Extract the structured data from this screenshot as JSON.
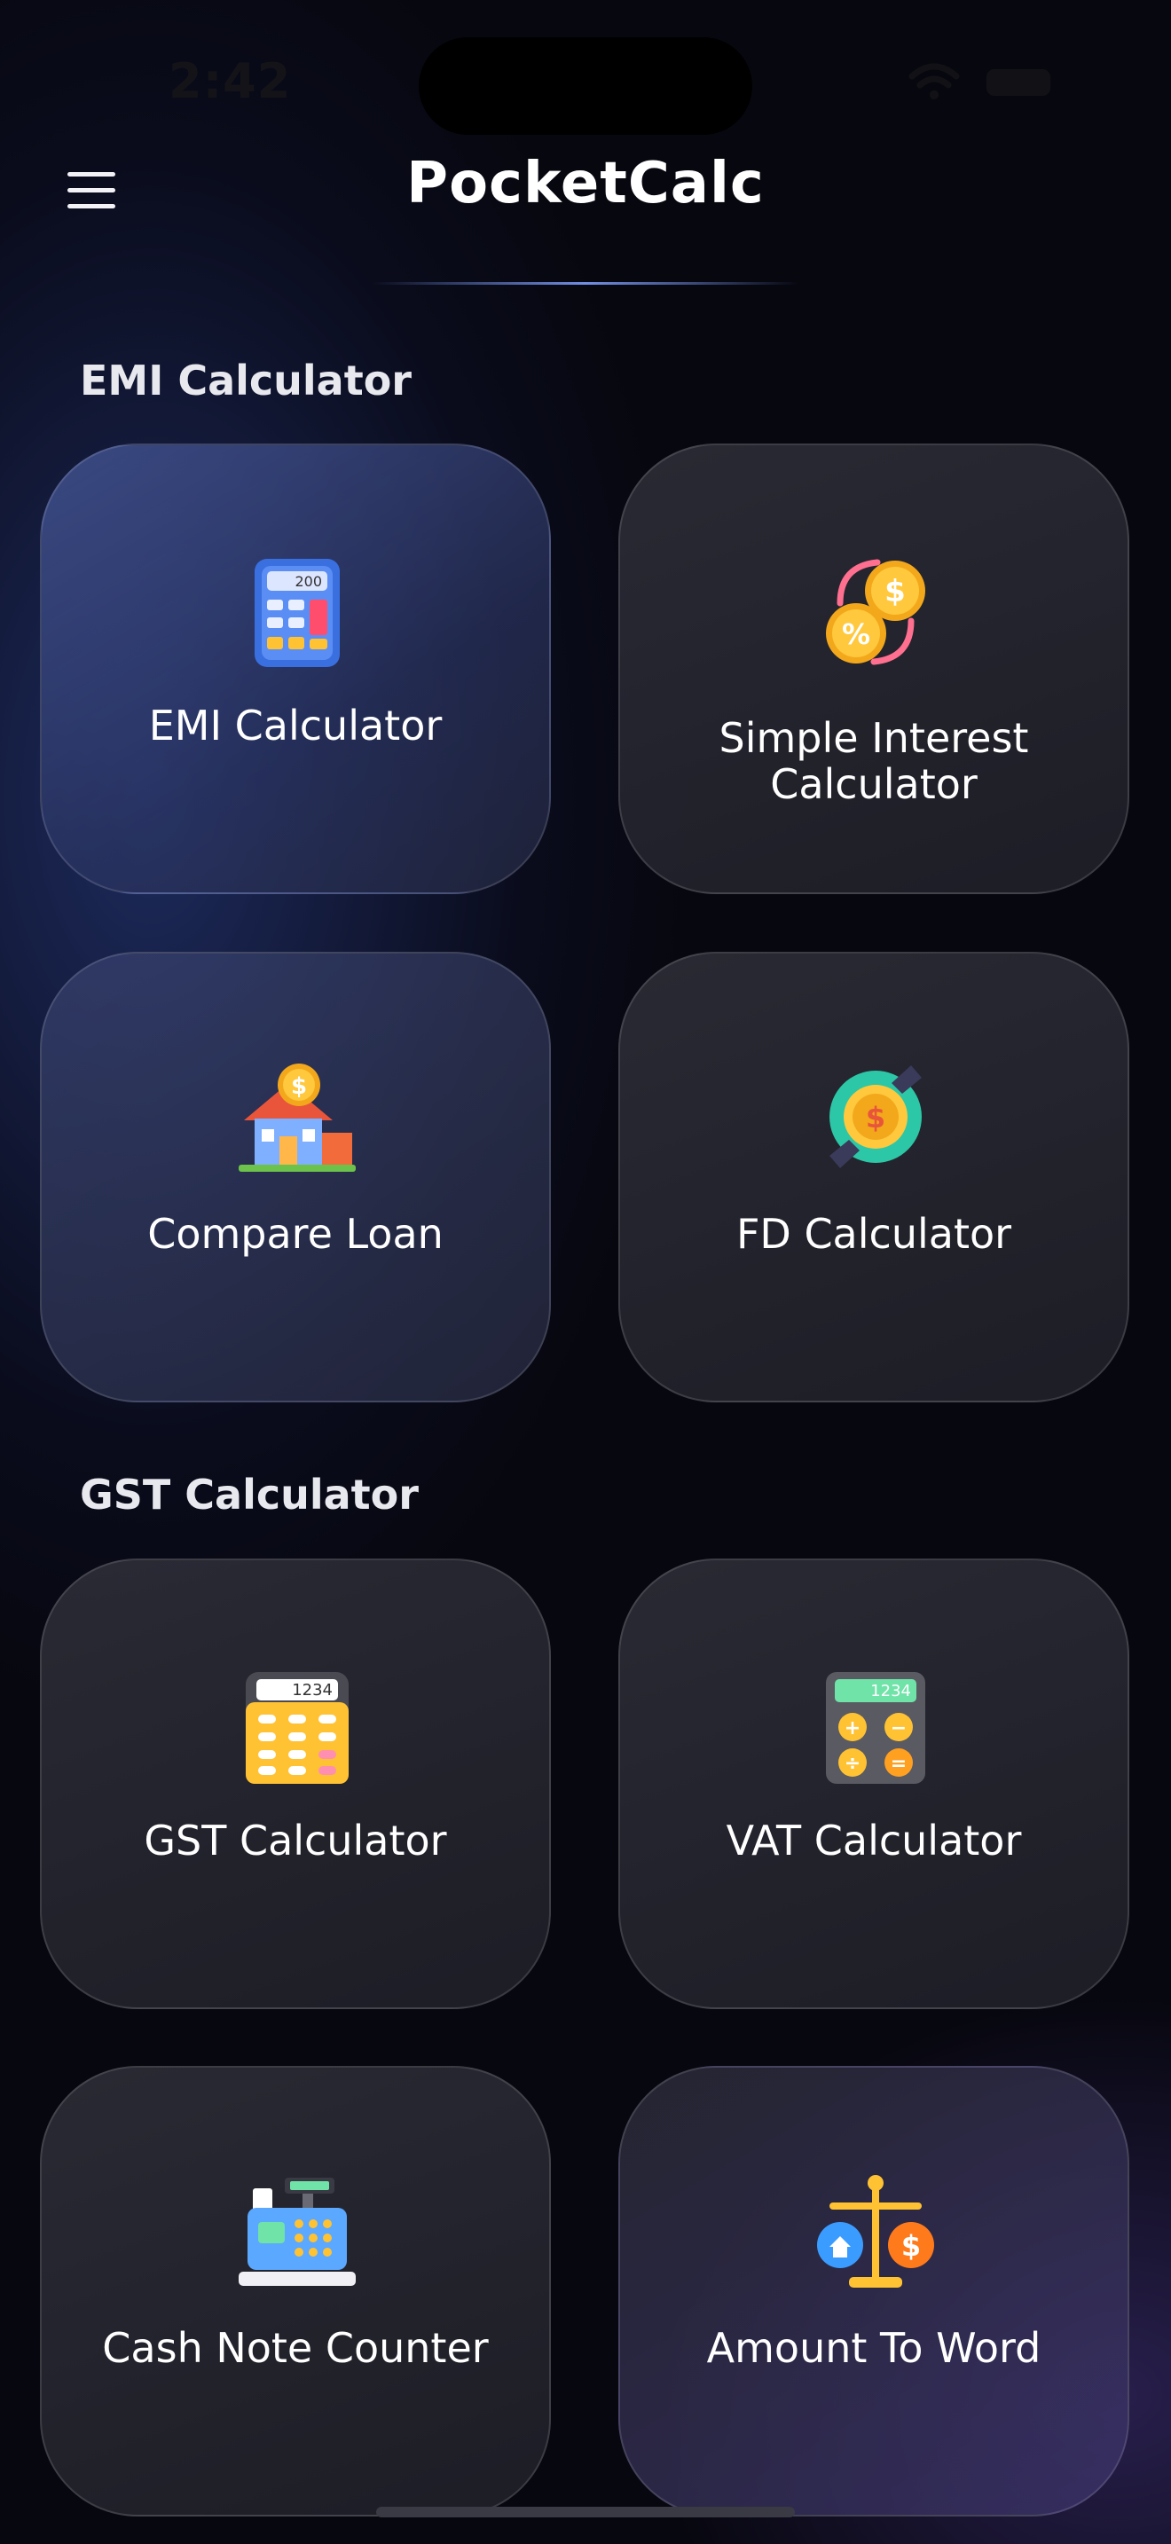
{
  "status_bar": {
    "time": "2:42",
    "wifi_icon": "wifi-icon",
    "battery_icon": "battery-icon"
  },
  "header": {
    "title": "PocketCalc",
    "menu_icon": "hamburger-menu-icon"
  },
  "sections": [
    {
      "title": "EMI Calculator",
      "cards": [
        {
          "label": "EMI Calculator",
          "icon": "calculator-icon"
        },
        {
          "label": "Simple Interest Calculator",
          "icon": "percent-coins-icon"
        },
        {
          "label": "Compare Loan",
          "icon": "house-loan-icon"
        },
        {
          "label": "FD Calculator",
          "icon": "fixed-deposit-coin-icon"
        }
      ]
    },
    {
      "title": "GST Calculator",
      "cards": [
        {
          "label": "GST Calculator",
          "icon": "gst-calculator-icon",
          "display": "1234"
        },
        {
          "label": "VAT Calculator",
          "icon": "vat-calculator-icon",
          "display": "1234"
        },
        {
          "label": "Cash Note Counter",
          "icon": "cash-register-icon"
        },
        {
          "label": "Amount To Word",
          "icon": "balance-scale-icon"
        }
      ]
    }
  ],
  "colors": {
    "background": "#07070f",
    "card": "#2a2a34",
    "accent_blue": "#3c5cc8",
    "text": "#ffffff"
  }
}
